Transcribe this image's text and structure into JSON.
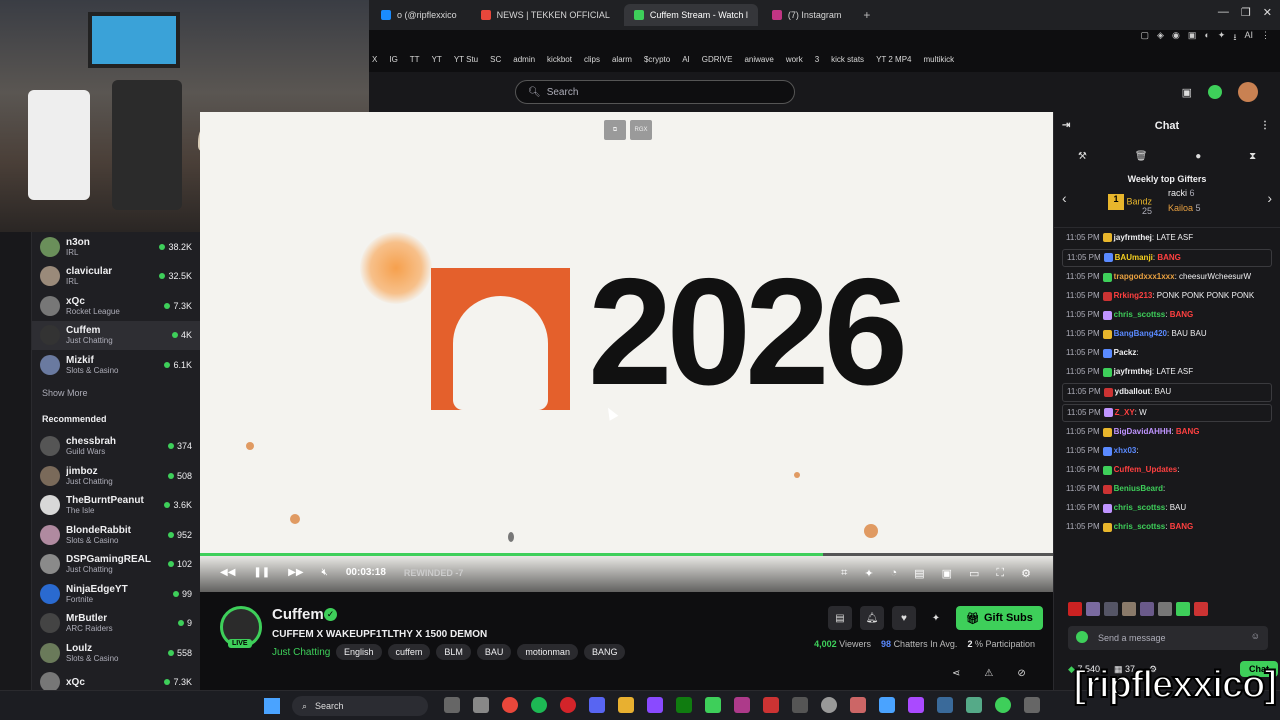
{
  "browser": {
    "tabs": [
      {
        "label": "o (@ripflexxico",
        "active": false
      },
      {
        "label": "NEWS | TEKKEN OFFICIAL",
        "active": false
      },
      {
        "label": "Cuffem Stream - Watch l",
        "active": true
      },
      {
        "label": "(7) Instagram",
        "active": false
      }
    ],
    "new_tab": "+",
    "bookmarks": [
      "X",
      "IG",
      "TT",
      "YT",
      "YT Stu",
      "SC",
      "admin",
      "kickbot",
      "clips",
      "alarm",
      "$crypto",
      "AI",
      "GDRIVE",
      "aniwave",
      "work",
      "3",
      "kick stats",
      "YT 2 MP4",
      "multikick"
    ],
    "window_controls": [
      "—",
      "❐",
      "✕"
    ],
    "toolbar_ai": "AI"
  },
  "twitch": {
    "search_placeholder": "Search"
  },
  "sidebar": {
    "followed": [
      {
        "name": "n3on",
        "game": "IRL",
        "viewers": "38.2K",
        "color": "#6a8f5a"
      },
      {
        "name": "clavicular",
        "game": "IRL",
        "viewers": "32.5K",
        "color": "#9a8a7a"
      },
      {
        "name": "xQc",
        "game": "Rocket League",
        "viewers": "7.3K",
        "color": "#777"
      },
      {
        "name": "Cuffem",
        "game": "Just Chatting",
        "viewers": "4K",
        "color": "#333",
        "selected": true
      },
      {
        "name": "Mizkif",
        "game": "Slots & Casino",
        "viewers": "6.1K",
        "color": "#6a7aa0"
      }
    ],
    "show_more": "Show More",
    "recommended_header": "Recommended",
    "recommended": [
      {
        "name": "chessbrah",
        "game": "Guild Wars",
        "viewers": "374",
        "color": "#555"
      },
      {
        "name": "jimboz",
        "game": "Just Chatting",
        "viewers": "508",
        "color": "#7a6a5a"
      },
      {
        "name": "TheBurntPeanut",
        "game": "The Isle",
        "viewers": "3.6K",
        "color": "#d8d8d8"
      },
      {
        "name": "BlondeRabbit",
        "game": "Slots & Casino",
        "viewers": "952",
        "color": "#b08aa0"
      },
      {
        "name": "DSPGamingREAL",
        "game": "Just Chatting",
        "viewers": "102",
        "color": "#8a8a8a"
      },
      {
        "name": "NinjaEdgeYT",
        "game": "Fortnite",
        "viewers": "99",
        "color": "#2a6ad0"
      },
      {
        "name": "MrButler",
        "game": "ARC Raiders",
        "viewers": "9",
        "color": "#444"
      },
      {
        "name": "Loulz",
        "game": "Slots & Casino",
        "viewers": "558",
        "color": "#6a7a5a"
      },
      {
        "name": "xQc",
        "game": "",
        "viewers": "7.3K",
        "color": "#777"
      }
    ]
  },
  "player": {
    "overlay_text": "2026",
    "rgx_label": "RGX",
    "progress_fraction": 0.73,
    "time": "00:03:18",
    "rewind_label": "REWINDED -7"
  },
  "stream": {
    "streamer": "Cuffem",
    "live_badge": "LIVE",
    "title": "CUFFEM X WAKEUPF1TLTHY X 1500 DEMON",
    "category": "Just Chatting",
    "tags": [
      "English",
      "cuffem",
      "BLM",
      "BAU",
      "motionman",
      "BANG"
    ],
    "gift_label": "Gift Subs",
    "viewers": "4,002",
    "viewers_label": "Viewers",
    "chatters": "98",
    "chatters_label": "Chatters In Avg.",
    "participation": "2",
    "participation_label": "% Participation"
  },
  "chat": {
    "title": "Chat",
    "gifters_title": "Weekly top Gifters",
    "gifters": [
      {
        "name": "Bandz",
        "count": "25"
      },
      {
        "name": "racki",
        "count": "6"
      },
      {
        "name": "Kailoa",
        "count": "5"
      }
    ],
    "messages": [
      {
        "time": "11:05 PM",
        "user": "jayfrmthej",
        "color": "#efeff1",
        "text": "LATE ASF",
        "hl": false
      },
      {
        "time": "11:05 PM",
        "user": "BAUmanji",
        "color": "#f5d020",
        "text": "BANG",
        "hl": true
      },
      {
        "time": "11:05 PM",
        "user": "trapgodxxx1xxx",
        "color": "#e8a040",
        "text": "cheesurWcheesurW",
        "hl": false
      },
      {
        "time": "11:05 PM",
        "user": "Rrking213",
        "color": "#ff4040",
        "text": "PONK PONK PONK PONK",
        "hl": false
      },
      {
        "time": "11:05 PM",
        "user": "chris_scottss",
        "color": "#3ecf5a",
        "text": "BANG",
        "hl": false
      },
      {
        "time": "11:05 PM",
        "user": "BangBang420",
        "color": "#5a8aff",
        "text": "BAU BAU",
        "hl": false
      },
      {
        "time": "11:05 PM",
        "user": "Packz",
        "color": "#efeff1",
        "text": "",
        "hl": false
      },
      {
        "time": "11:05 PM",
        "user": "jayfrmthej",
        "color": "#efeff1",
        "text": "LATE ASF",
        "hl": false
      },
      {
        "time": "11:05 PM",
        "user": "ydballout",
        "color": "#efeff1",
        "text": "BAU",
        "hl": true
      },
      {
        "time": "11:05 PM",
        "user": "Z_XY",
        "color": "#ff4040",
        "text": "W",
        "hl": true
      },
      {
        "time": "11:05 PM",
        "user": "BigDavidAHHH",
        "color": "#bf94ff",
        "text": "BANG",
        "hl": false
      },
      {
        "time": "11:05 PM",
        "user": "xhx03",
        "color": "#5a8aff",
        "text": "",
        "hl": false
      },
      {
        "time": "11:05 PM",
        "user": "Cuffem_Updates",
        "color": "#ff4040",
        "text": "",
        "hl": false
      },
      {
        "time": "11:05 PM",
        "user": "BeniusBeard",
        "color": "#3ecf5a",
        "text": "",
        "hl": false
      },
      {
        "time": "11:05 PM",
        "user": "chris_scottss",
        "color": "#3ecf5a",
        "text": "BAU",
        "hl": false
      },
      {
        "time": "11:05 PM",
        "user": "chris_scottss",
        "color": "#3ecf5a",
        "text": "BANG",
        "hl": false
      }
    ],
    "send_placeholder": "Send a message",
    "points": "7,540",
    "pending": "37",
    "chat_button": "Chat"
  },
  "taskbar": {
    "search_label": "Search"
  },
  "watermark": "[ripflexxico]"
}
